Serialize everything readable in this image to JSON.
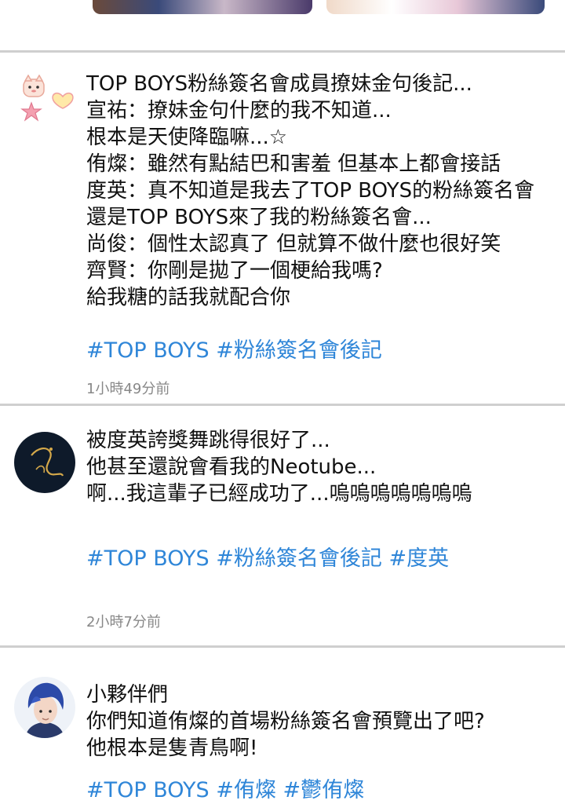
{
  "posts": [
    {
      "text": "TOP BOYS粉絲簽名會成員撩妹金句後記...\n宣祐：撩妹金句什麼的我不知道...\n根本是天使降臨嘛...☆\n侑燦：雖然有點結巴和害羞 但基本上都會接話\n度英：真不知道是我去了TOP BOYS的粉絲簽名會\n還是TOP BOYS來了我的粉絲簽名會...\n尚俊：個性太認真了 但就算不做什麼也很好笑\n齊賢：你剛是拋了一個梗給我嗎?\n給我糖的話我就配合你",
      "hashtags": [
        "#TOP BOYS",
        "#粉絲簽名會後記"
      ],
      "time": "1小時49分前"
    },
    {
      "text": "被度英誇獎舞跳得很好了...\n他甚至還說會看我的Neotube...\n啊...我這輩子已經成功了...嗚嗚嗚嗚嗚嗚嗚",
      "hashtags": [
        "#TOP BOYS",
        "#粉絲簽名會後記",
        "#度英"
      ],
      "time": "2小時7分前"
    },
    {
      "text": "小夥伴們\n你們知道侑燦的首場粉絲簽名會預覽出了吧?\n他根本是隻青鳥啊!",
      "hashtags": [
        "#TOP BOYS",
        "#侑燦",
        "#鬱侑燦"
      ],
      "time": ""
    }
  ],
  "colors": {
    "hashtag": "#2f86d8",
    "time": "#888888",
    "divider": "#cfcfcf"
  },
  "icons": [
    "sticker-avatar",
    "dark-avatar",
    "character-avatar"
  ]
}
